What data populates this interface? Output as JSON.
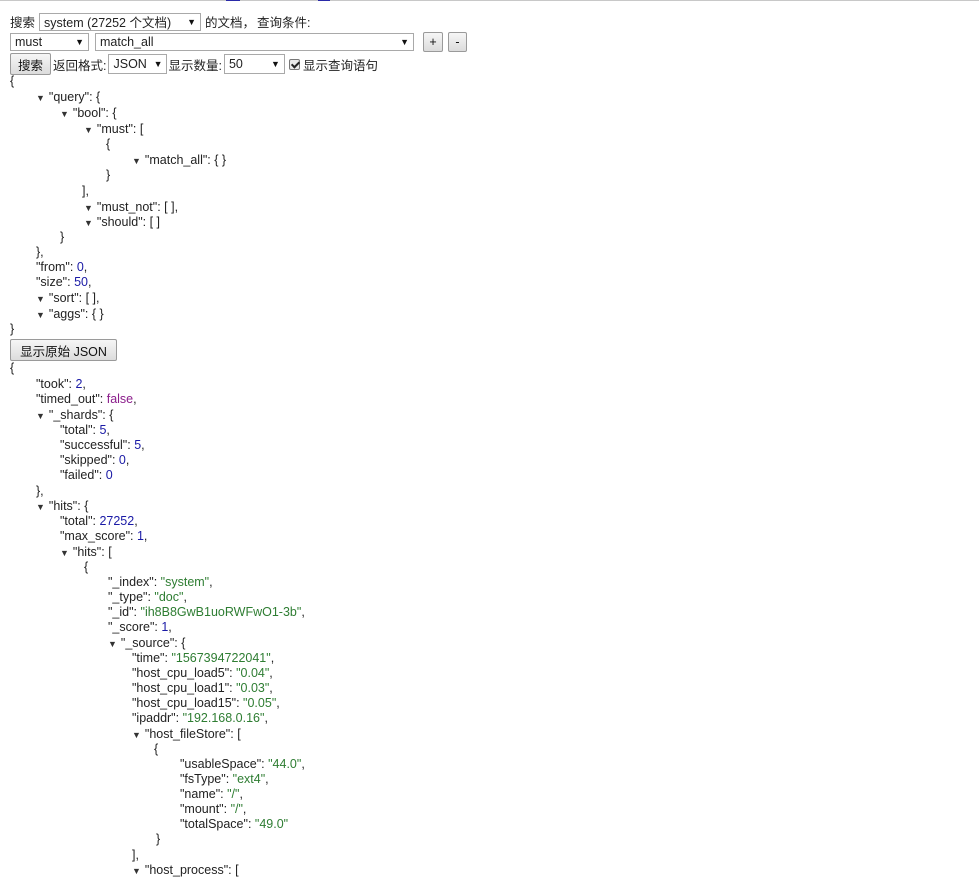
{
  "top": {
    "search_label": "搜索",
    "index_select": "system (27252 个文档)",
    "docs_label": "的文档，",
    "query_cond_label": "查询条件:"
  },
  "query_row": {
    "bool_select": "must",
    "field_select": "match_all",
    "add_label": "+",
    "remove_label": "-"
  },
  "options": {
    "search_button": "搜索",
    "return_format_label": "返回格式:",
    "format_select": "JSON",
    "show_count_label": "显示数量:",
    "count_select": "50",
    "show_query_checkbox_label": "显示查询语句"
  },
  "query_tree": [
    {
      "t": "{"
    },
    {
      "k": "query",
      "open": "{"
    },
    {
      "k": "bool",
      "open": "{"
    },
    {
      "k": "must",
      "open": "["
    },
    {
      "t": "{"
    },
    {
      "k": "match_all",
      "open": "{ }"
    },
    {
      "t": "}"
    },
    {
      "t": "],"
    },
    {
      "k": "must_not",
      "open": "[ ],"
    },
    {
      "k": "should",
      "open": "[ ]"
    },
    {
      "t": "}"
    },
    {
      "t": "},"
    },
    {
      "k": "from",
      "n": "0"
    },
    {
      "k": "size",
      "n": "50"
    },
    {
      "k": "sort",
      "open": "[ ],"
    },
    {
      "k": "aggs",
      "open": "{ }"
    },
    {
      "t": "}"
    }
  ],
  "raw_button": "显示原始 JSON",
  "result_tree": [
    {
      "t": "{"
    },
    {
      "k": "took",
      "n": "2"
    },
    {
      "k": "timed_out",
      "b": "false"
    },
    {
      "k": "_shards",
      "open": "{"
    },
    {
      "k": "total",
      "n": "5"
    },
    {
      "k": "successful",
      "n": "5"
    },
    {
      "k": "skipped",
      "n": "0"
    },
    {
      "k": "failed",
      "n": "0",
      "last": true
    },
    {
      "t": "},"
    },
    {
      "k": "hits",
      "open": "{"
    },
    {
      "k": "total",
      "n": "27252"
    },
    {
      "k": "max_score",
      "n": "1"
    },
    {
      "k": "hits",
      "open": "["
    },
    {
      "t": "{"
    },
    {
      "k": "_index",
      "s": "system"
    },
    {
      "k": "_type",
      "s": "doc"
    },
    {
      "k": "_id",
      "s": "ih8B8GwB1uoRWFwO1-3b"
    },
    {
      "k": "_score",
      "n": "1"
    },
    {
      "k": "_source",
      "open": "{"
    },
    {
      "k": "time",
      "s": "1567394722041"
    },
    {
      "k": "host_cpu_load5",
      "s": "0.04"
    },
    {
      "k": "host_cpu_load1",
      "s": "0.03"
    },
    {
      "k": "host_cpu_load15",
      "s": "0.05"
    },
    {
      "k": "ipaddr",
      "s": "192.168.0.16"
    },
    {
      "k": "host_fileStore",
      "open": "["
    },
    {
      "t": "{"
    },
    {
      "k": "usableSpace",
      "s": "44.0"
    },
    {
      "k": "fsType",
      "s": "ext4"
    },
    {
      "k": "name",
      "s": "/"
    },
    {
      "k": "mount",
      "s": "/"
    },
    {
      "k": "totalSpace",
      "s": "49.0",
      "last": true
    },
    {
      "t": "}"
    },
    {
      "t": "],"
    },
    {
      "k": "host_process",
      "open": "["
    }
  ],
  "colors": {
    "number": "#1a1aa6",
    "string": "#2e7d32",
    "boolean": "#8b1d8b"
  }
}
